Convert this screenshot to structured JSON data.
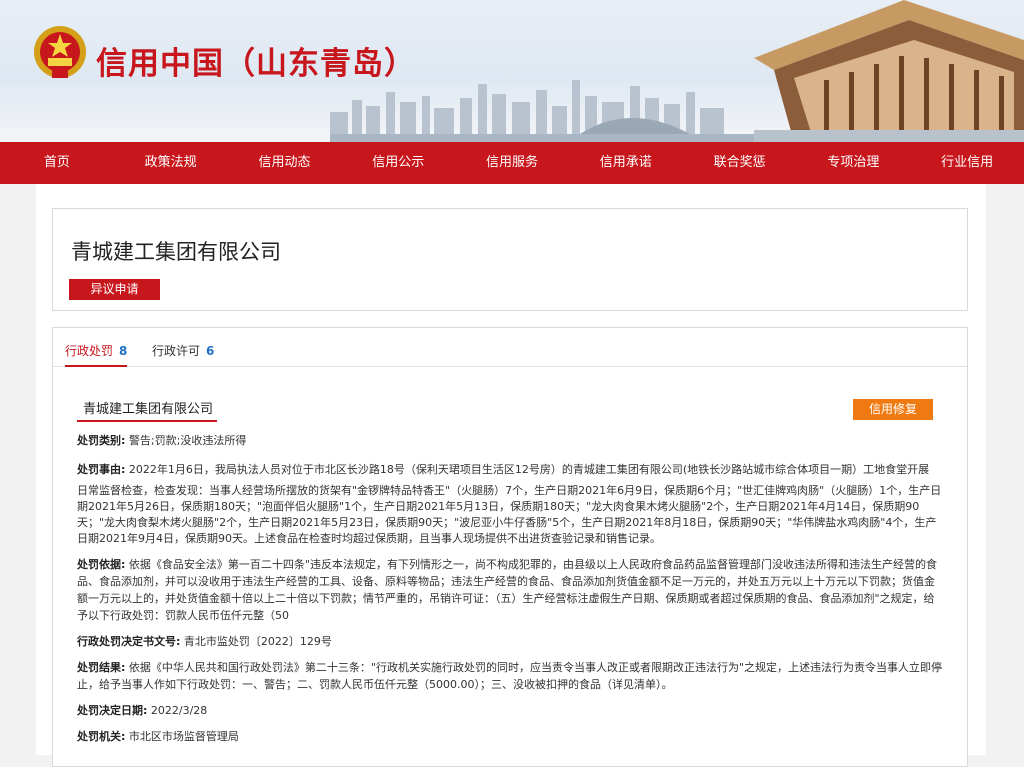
{
  "site": {
    "title": "信用中国（山东青岛）"
  },
  "nav": {
    "items": [
      "首页",
      "政策法规",
      "信用动态",
      "信用公示",
      "信用服务",
      "信用承诺",
      "联合奖惩",
      "专项治理",
      "行业信用"
    ]
  },
  "company": {
    "name": "青城建工集团有限公司",
    "objection_label": "异议申请"
  },
  "tabs": [
    {
      "label": "行政处罚",
      "count": "8"
    },
    {
      "label": "行政许可",
      "count": "6"
    }
  ],
  "record": {
    "name": "青城建工集团有限公司",
    "repair_label": "信用修复",
    "fields": {
      "category_label": "处罚类别:",
      "category": "警告;罚款;没收违法所得",
      "cause_label": "处罚事由:",
      "cause_intro": "2022年1月6日，我局执法人员对位于市北区长沙路18号（保利天珺项目生活区12号房）的青城建工集团有限公司(地铁长沙路站城市综合体项目一期）工地食堂开展",
      "cause_body": "日常监督检查，检查发现：当事人经营场所摆放的货架有\"金锣牌特品特香王\"（火腿肠）7个，生产日期2021年6月9日，保质期6个月；\"世汇佳牌鸡肉肠\"（火腿肠）1个，生产日期2021年5月26日，保质期180天；\"泡面伴侣火腿肠\"1个，生产日期2021年5月13日，保质期180天；\"龙大肉食果木烤火腿肠\"2个，生产日期2021年4月14日，保质期90天；\"龙大肉食梨木烤火腿肠\"2个，生产日期2021年5月23日，保质期90天；\"波尼亚小牛仔香肠\"5个，生产日期2021年8月18日，保质期90天；\"华伟牌盐水鸡肉肠\"4个，生产日期2021年9月4日，保质期90天。上述食品在检查时均超过保质期，且当事人现场提供不出进货查验记录和销售记录。",
      "basis_label": "处罚依据:",
      "basis": "依据《食品安全法》第一百二十四条\"违反本法规定，有下列情形之一，尚不构成犯罪的，由县级以上人民政府食品药品监督管理部门没收违法所得和违法生产经营的食品、食品添加剂，并可以没收用于违法生产经营的工具、设备、原料等物品；违法生产经营的食品、食品添加剂货值金额不足一万元的，并处五万元以上十万元以下罚款；货值金额一万元以上的，并处货值金额十倍以上二十倍以下罚款；情节严重的，吊销许可证：（五）生产经营标注虚假生产日期、保质期或者超过保质期的食品、食品添加剂\"之规定，给予以下行政处罚：罚款人民币伍仟元整（50",
      "doc_label": "行政处罚决定书文号:",
      "doc": "青北市监处罚〔2022〕129号",
      "result_label": "处罚结果:",
      "result": "依据《中华人民共和国行政处罚法》第二十三条：\"行政机关实施行政处罚的同时，应当责令当事人改正或者限期改正违法行为\"之规定，上述违法行为责令当事人立即停止，给予当事人作如下行政处罚：一、警告；二、罚款人民币伍仟元整（5000.00）；三、没收被扣押的食品（详见清单）。",
      "date_label": "处罚决定日期:",
      "date": "2022/3/28",
      "authority_label": "处罚机关:",
      "authority": "市北区市场监督管理局"
    }
  },
  "colors": {
    "brand_red": "#c8161d",
    "accent_orange": "#f07a12",
    "count_blue": "#1f6fc5"
  }
}
